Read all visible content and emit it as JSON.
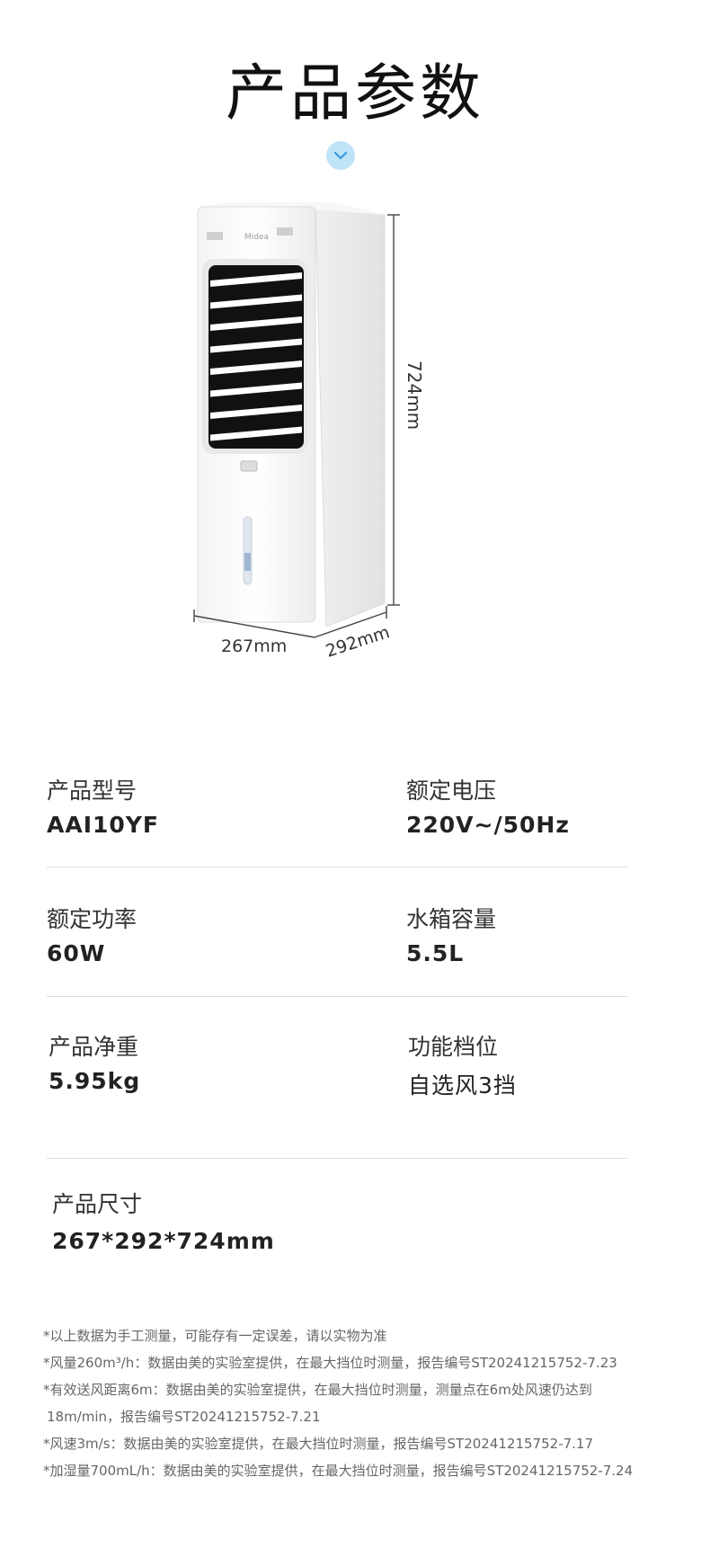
{
  "title": "产品参数",
  "figure": {
    "brand": "Midea",
    "height_label": "724mm",
    "width_label": "267mm",
    "depth_label": "292mm"
  },
  "specs": [
    {
      "label": "产品型号",
      "value": "AAI10YF"
    },
    {
      "label": "额定电压",
      "value": "220V~/50Hz"
    },
    {
      "label": "额定功率",
      "value": "60W"
    },
    {
      "label": "水箱容量",
      "value": "5.5L"
    },
    {
      "label": "产品净重",
      "value": "5.95kg"
    },
    {
      "label": "功能档位",
      "value": "自选风3挡"
    },
    {
      "label": "产品尺寸",
      "value": "267*292*724mm"
    }
  ],
  "notes": [
    "*以上数据为手工测量，可能存有一定误差，请以实物为准",
    "*风量260m³/h：数据由美的实验室提供，在最大挡位时测量，报告编号ST20241215752-7.23",
    "*有效送风距离6m：数据由美的实验室提供，在最大挡位时测量，测量点在6m处风速仍达到",
    "18m/min，报告编号ST20241215752-7.21",
    "*风速3m/s：数据由美的实验室提供，在最大挡位时测量，报告编号ST20241215752-7.17",
    "*加湿量700mL/h：数据由美的实验室提供，在最大挡位时测量，报告编号ST20241215752-7.24"
  ],
  "colors": {
    "accent": "#bfe3f7",
    "chevron": "#3a9be0"
  }
}
